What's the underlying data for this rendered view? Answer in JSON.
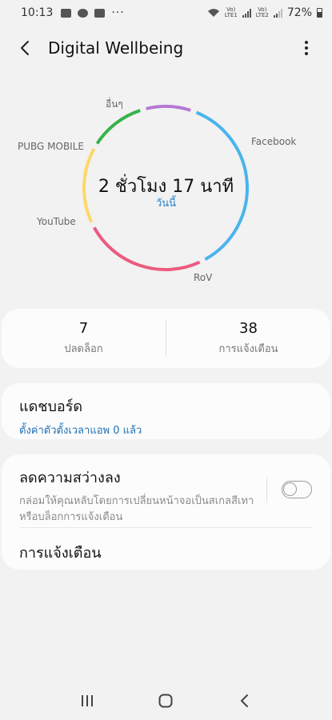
{
  "status_bar": {
    "time": "10:13",
    "dots": "···",
    "lte1": "Vo)\nLTE1",
    "lte2": "Vo)\nLTE2",
    "battery": "72%",
    "icons": [
      "gallery-icon",
      "chrome-icon",
      "shop-icon",
      "wifi-icon",
      "signal-icon",
      "battery-icon"
    ]
  },
  "header": {
    "title": "Digital Wellbeing"
  },
  "usage": {
    "total": "2 ชั่วโมง 17 นาที",
    "period": "วันนี้"
  },
  "chart_data": {
    "type": "pie",
    "style": "donut-ring",
    "categories": [
      "Facebook",
      "RoV",
      "YouTube",
      "PUBG MOBILE",
      "อื่นๆ"
    ],
    "colors": [
      "#4ab4ec",
      "#ec5b80",
      "#fcd867",
      "#37b34a",
      "#b678d6"
    ],
    "fractions": [
      0.37,
      0.25,
      0.16,
      0.12,
      0.1
    ],
    "legend": "labels-around-ring"
  },
  "stats": {
    "unlocks_value": "7",
    "unlocks_label": "ปลดล็อก",
    "notifications_value": "38",
    "notifications_label": "การแจ้งเตือน"
  },
  "dashboard": {
    "title": "แดชบอร์ด",
    "subtitle": "ตั้งค่าตัวตั้งเวลาแอพ 0 แล้ว"
  },
  "wind_down": {
    "title": "ลดความสว่างลง",
    "description": "กล่อมให้คุณหลับโดยการเปลี่ยนหน้าจอเป็นสเกลสีเทาหรือบล็อกการแจ้งเตือน",
    "enabled": false
  },
  "notifications_item": {
    "title": "การแจ้งเตือน"
  },
  "navbar": {
    "buttons": [
      "recents-icon",
      "home-icon",
      "back-icon"
    ]
  },
  "colors": {
    "accent_blue": "#1f6fb5",
    "background": "#f2f2f2",
    "card": "#fcfcfc"
  }
}
